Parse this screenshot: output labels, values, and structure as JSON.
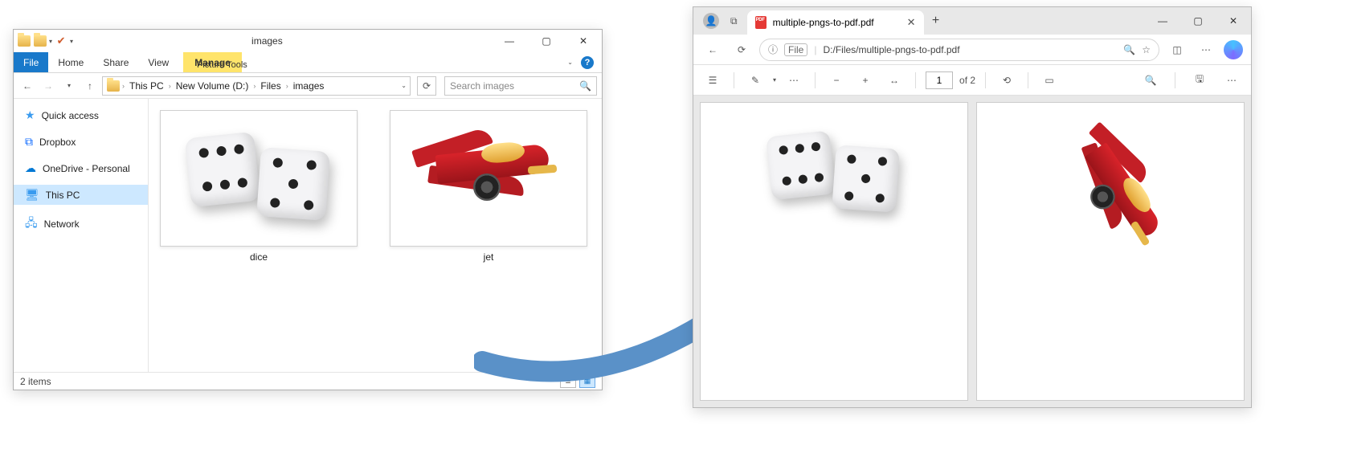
{
  "explorer": {
    "ribbon": {
      "manage": "Manage",
      "picture_tools": "Picture Tools",
      "windowTitle": "images",
      "file": "File",
      "home": "Home",
      "share": "Share",
      "view": "View"
    },
    "breadcrumb": [
      "This PC",
      "New Volume (D:)",
      "Files",
      "images"
    ],
    "search_placeholder": "Search images",
    "sidebar": {
      "items": [
        {
          "label": "Quick access"
        },
        {
          "label": "Dropbox"
        },
        {
          "label": "OneDrive - Personal"
        },
        {
          "label": "This PC"
        },
        {
          "label": "Network"
        }
      ]
    },
    "files": [
      {
        "name": "dice"
      },
      {
        "name": "jet"
      }
    ],
    "status": "2 items"
  },
  "edge": {
    "tab_title": "multiple-pngs-to-pdf.pdf",
    "file_badge": "File",
    "url": "D:/Files/multiple-pngs-to-pdf.pdf",
    "pdf": {
      "page_current": "1",
      "page_total": "of 2"
    }
  }
}
